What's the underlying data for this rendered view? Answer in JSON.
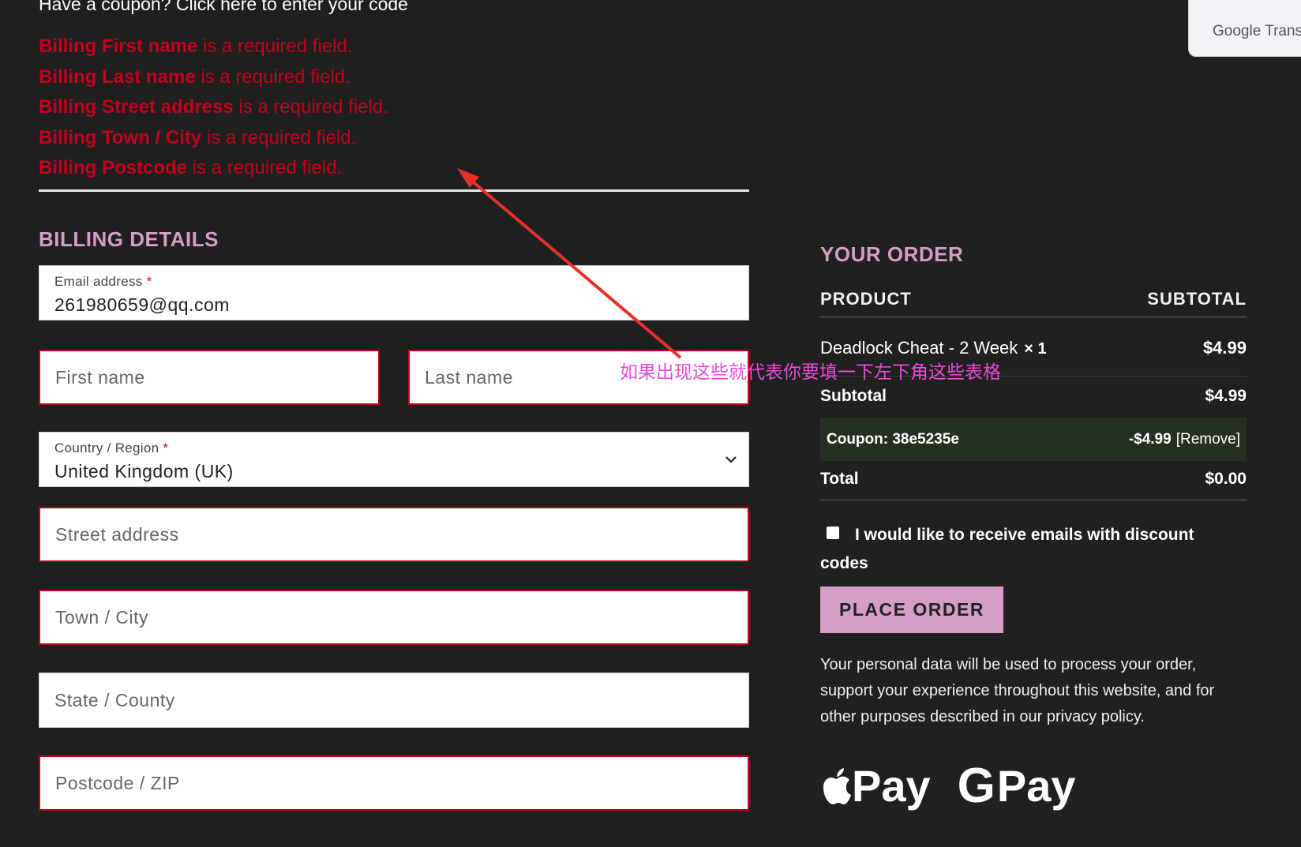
{
  "coupon_prompt": "Have a coupon? Click here to enter your code",
  "errors": [
    {
      "field": "Billing First name",
      "msg": " is a required field."
    },
    {
      "field": "Billing Last name",
      "msg": " is a required field."
    },
    {
      "field": "Billing Street address",
      "msg": " is a required field."
    },
    {
      "field": "Billing Town / City",
      "msg": " is a required field."
    },
    {
      "field": "Billing Postcode",
      "msg": " is a required field."
    }
  ],
  "billing": {
    "title": "BILLING DETAILS",
    "email": {
      "label": "Email address",
      "required": "*",
      "value": "261980659@qq.com"
    },
    "first_name": {
      "placeholder": "First name"
    },
    "last_name": {
      "placeholder": "Last name"
    },
    "country": {
      "label": "Country / Region",
      "required": "*",
      "value": "United Kingdom (UK)"
    },
    "street": {
      "placeholder": "Street address"
    },
    "town": {
      "placeholder": "Town / City"
    },
    "state": {
      "placeholder": "State / County"
    },
    "postcode": {
      "placeholder": "Postcode / ZIP"
    }
  },
  "order": {
    "title": "YOUR ORDER",
    "col_product": "PRODUCT",
    "col_subtotal": "SUBTOTAL",
    "item": {
      "name": "Deadlock Cheat - 2 Week",
      "qty": "× 1",
      "amount": "$4.99"
    },
    "subtotal_label": "Subtotal",
    "subtotal_value": "$4.99",
    "coupon_label": "Coupon: 38e5235e",
    "coupon_amount": "-$4.99",
    "coupon_remove": "[Remove]",
    "total_label": "Total",
    "total_value": "$0.00",
    "newsletter": "I would like to receive emails with discount codes",
    "place_order": "PLACE ORDER",
    "privacy": "Your personal data will be used to process your order, support your experience throughout this website, and for other purposes described in our privacy policy."
  },
  "payments": {
    "apple": "Pay",
    "google_g": "G",
    "google": "Pay"
  },
  "translate_widget": "Google Transla",
  "annotation": "如果出现这些就代表你要填一下左下角这些表格",
  "colors": {
    "background": "#1f1f1f",
    "error": "#c4001e",
    "accent": "#d59ec5",
    "annotation": "#e94bd8",
    "arrow": "#e8302a"
  }
}
